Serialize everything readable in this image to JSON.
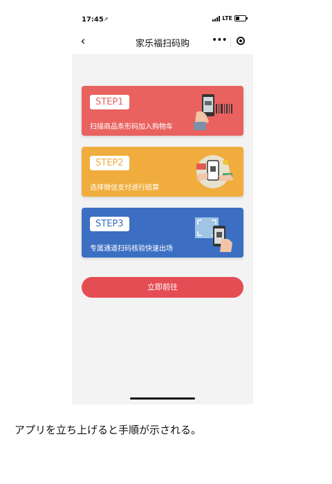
{
  "status_bar": {
    "time": "17:45",
    "location_glyph": "➚",
    "network": "LTE",
    "battery_level": 0.35
  },
  "navbar": {
    "back_glyph": "‹",
    "title": "家乐福扫码购",
    "more_glyph": "•••"
  },
  "steps": [
    {
      "label": "STEP1",
      "desc": "扫描商品条形码加入购物车",
      "color": "#e9625f"
    },
    {
      "label": "STEP2",
      "desc": "选择微信支付进行结算",
      "color": "#f0ad3d"
    },
    {
      "label": "STEP3",
      "desc": "专属通道扫码核验快速出场",
      "color": "#3c6fc2"
    }
  ],
  "go_button": {
    "label": "立即前往",
    "color": "#e54d55"
  },
  "caption": "アプリを立ち上げると手順が示される。"
}
